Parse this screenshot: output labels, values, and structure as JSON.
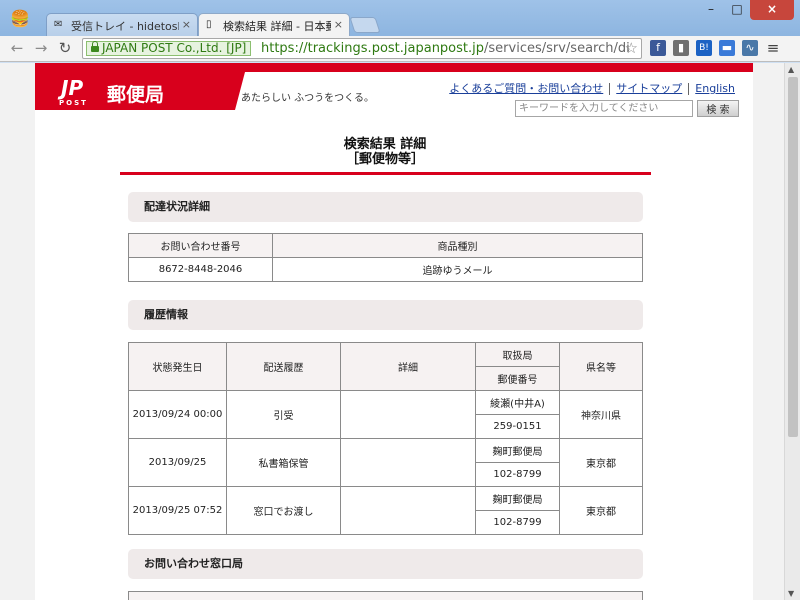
{
  "browser": {
    "tabs": [
      {
        "label": "受信トレイ - hidetoshi.yan",
        "favicon": "mail-icon"
      },
      {
        "label": "検索結果 詳細 - 日本郵便",
        "favicon": "page-icon"
      }
    ],
    "url_org": "JAPAN POST Co.,Ltd. [JP]",
    "url_scheme_host": "https://trackings.post.japanpost.jp",
    "url_path": "/services/srv/search/di",
    "ext_colors": [
      "#3b5998",
      "#6f6f6f",
      "#1c62c4",
      "#3a7ad8",
      "#4a78a8"
    ]
  },
  "site": {
    "logo_jp": "JP",
    "logo_post": "POST",
    "logo_title": "郵便局",
    "tagline": "あたらしい ふつうをつくる。",
    "links": [
      "よくあるご質問・お問い合わせ",
      "サイトマップ",
      "English"
    ],
    "search_placeholder": "キーワードを入力してください",
    "search_button": "検 索",
    "brand_color": "#d8001c"
  },
  "main": {
    "title_line1": "検索結果 詳細",
    "title_line2": "［郵便物等］",
    "delivery_status": {
      "heading": "配達状況詳細",
      "headers": [
        "お問い合わせ番号",
        "商品種別"
      ],
      "row": [
        "8672-8448-2046",
        "追跡ゆうメール"
      ]
    },
    "history": {
      "heading": "履歴情報",
      "headers": {
        "date": "状態発生日",
        "status": "配送履歴",
        "detail": "詳細",
        "office": "取扱局",
        "postal": "郵便番号",
        "prefecture": "県名等"
      },
      "rows": [
        {
          "date": "2013/09/24 00:00",
          "status": "引受",
          "detail": "",
          "office": "綾瀬(中井A)",
          "postal": "259-0151",
          "prefecture": "神奈川県"
        },
        {
          "date": "2013/09/25",
          "status": "私書箱保管",
          "detail": "",
          "office": "麹町郵便局",
          "postal": "102-8799",
          "prefecture": "東京都"
        },
        {
          "date": "2013/09/25 07:52",
          "status": "窓口でお渡し",
          "detail": "",
          "office": "麹町郵便局",
          "postal": "102-8799",
          "prefecture": "東京都"
        }
      ]
    },
    "contact": {
      "heading": "お問い合わせ窓口局"
    }
  }
}
